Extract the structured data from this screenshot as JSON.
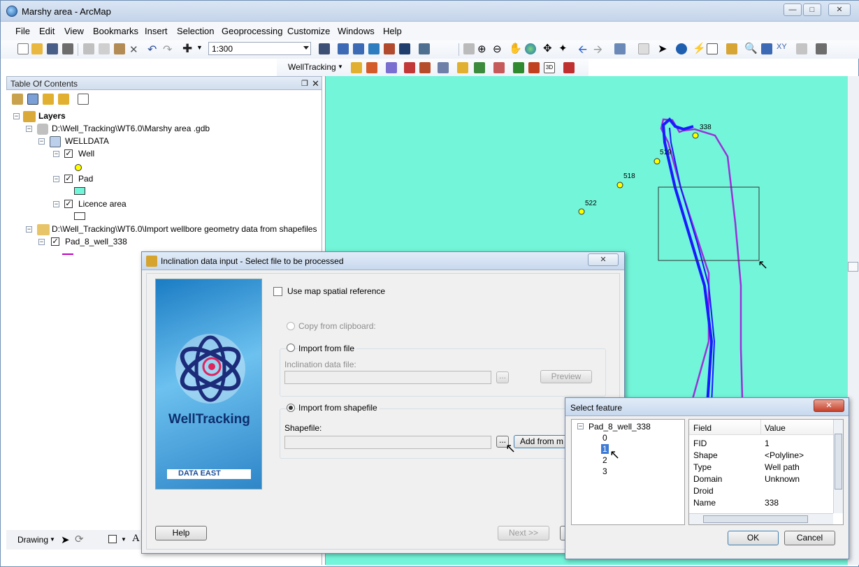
{
  "window": {
    "title": "Marshy area - ArcMap"
  },
  "menu": [
    "File",
    "Edit",
    "View",
    "Bookmarks",
    "Insert",
    "Selection",
    "Geoprocessing",
    "Customize",
    "Windows",
    "Help"
  ],
  "toolbar": {
    "scale": "1:300",
    "welltracking_label": "WellTracking"
  },
  "toc": {
    "title": "Table Of Contents",
    "layers_label": "Layers",
    "gdb_path": "D:\\Well_Tracking\\WT6.0\\Marshy area .gdb",
    "welldata": "WELLDATA",
    "well": "Well",
    "pad": "Pad",
    "licence": "Licence area",
    "shape_path": "D:\\Well_Tracking\\WT6.0\\Import wellbore geometry data from shapefiles",
    "pad_layer": "Pad_8_well_338"
  },
  "map": {
    "labels": [
      "338",
      "519",
      "518",
      "522"
    ],
    "colors": {
      "background": "#73f5da",
      "well_path": "#1a1aff",
      "outline": "#9b30d9",
      "well_point": "#ffff00"
    }
  },
  "inclination_dialog": {
    "title": "Inclination data input - Select file to be processed",
    "brand_name": "WellTracking",
    "brand_company": "DATA EAST",
    "use_map_ref": "Use map spatial reference",
    "copy_clipboard": "Copy from clipboard:",
    "import_file": "Import from file",
    "inclination_file_label": "Inclination data file:",
    "browse": "...",
    "preview": "Preview",
    "import_shapefile": "Import from shapefile",
    "shapefile_label": "Shapefile:",
    "add_from": "Add from m",
    "help": "Help",
    "next": "Next >>"
  },
  "select_feature": {
    "title": "Select feature",
    "tree_root": "Pad_8_well_338",
    "tree_items": [
      "0",
      "1",
      "2",
      "3"
    ],
    "headers": [
      "Field",
      "Value"
    ],
    "rows": [
      [
        "FID",
        "1"
      ],
      [
        "Shape",
        "<Polyline>"
      ],
      [
        "Type",
        "Well path"
      ],
      [
        "Domain",
        "Unknown"
      ],
      [
        "Droid",
        ""
      ],
      [
        "Name",
        "338"
      ]
    ],
    "ok": "OK",
    "cancel": "Cancel"
  },
  "drawing_toolbar": {
    "label": "Drawing"
  }
}
